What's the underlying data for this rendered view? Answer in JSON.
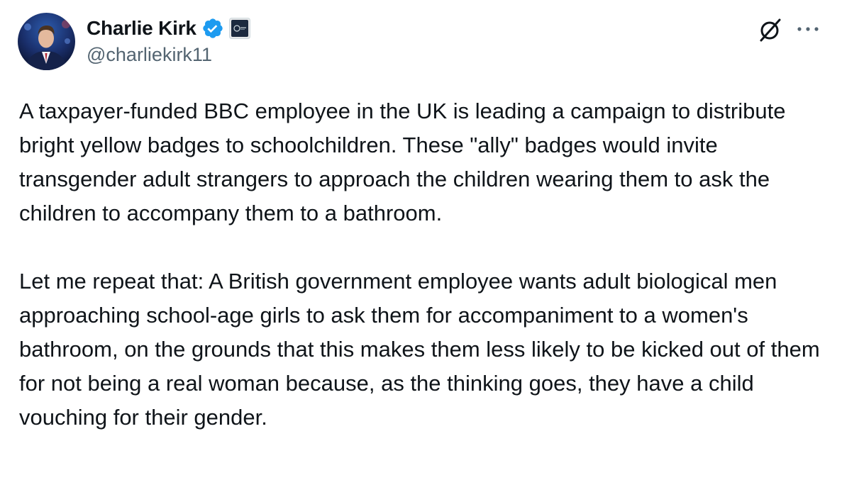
{
  "post": {
    "author": {
      "display_name": "Charlie Kirk",
      "handle": "@charliekirk11",
      "verified": true,
      "verified_color": "#1d9bf0",
      "affiliate_badge": "organization-affiliate-badge"
    },
    "actions": {
      "grok_icon": "grok-slash-icon",
      "more_icon": "more-horizontal-icon"
    },
    "paragraphs": [
      "A taxpayer-funded BBC employee in the UK is leading a campaign to distribute bright yellow badges to schoolchildren. These \"ally\" badges would invite transgender adult strangers to approach the children wearing them to ask the children to accompany them to a bathroom.",
      "Let me repeat that: A British government employee wants adult biological men approaching school-age girls to ask them for accompaniment to a women's bathroom, on the grounds that this makes them less likely to be kicked out of them for not being a real woman because, as the thinking goes, they have a child vouching for their gender."
    ]
  },
  "colors": {
    "text_primary": "#0f1419",
    "text_secondary": "#536471",
    "verified_blue": "#1d9bf0",
    "background": "#ffffff"
  }
}
